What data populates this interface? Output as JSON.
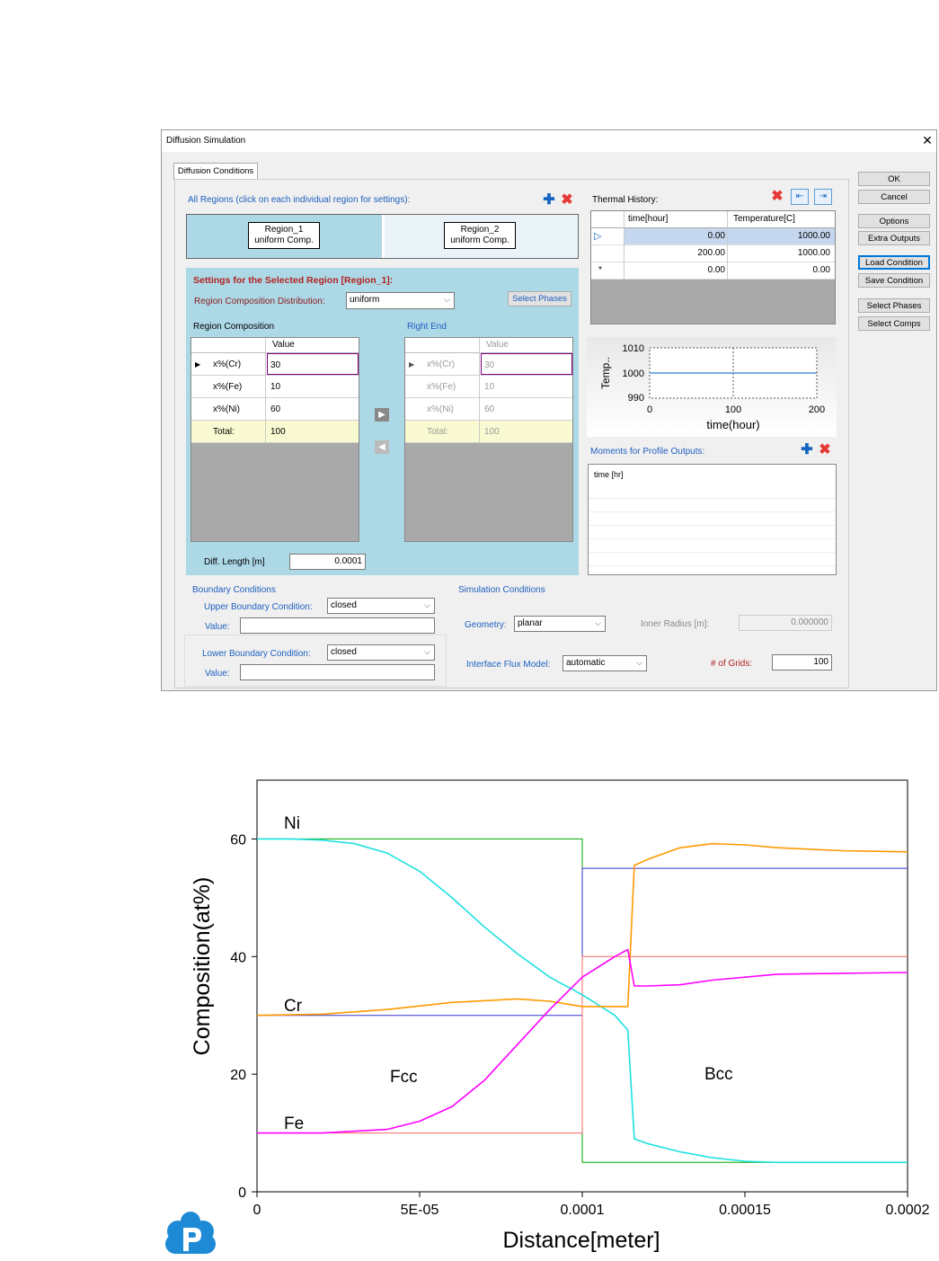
{
  "dialog": {
    "title": "Diffusion Simulation",
    "close": "✕",
    "tab": "Diffusion Conditions",
    "all_regions_label": "All Regions (click on each individual region for settings):",
    "regions": [
      {
        "name": "Region_1",
        "type": "uniform Comp."
      },
      {
        "name": "Region_2",
        "type": "uniform Comp."
      }
    ],
    "settings_title": "Settings for the Selected Region [Region_1]:",
    "distribution_label": "Region Composition Distribution:",
    "distribution_value": "uniform",
    "select_phases_inner": "Select Phases",
    "region_comp_label": "Region Composition",
    "right_end_label": "Right End",
    "comp_header": "Value",
    "comp_rows": [
      {
        "name": "x%(Cr)",
        "value": "30"
      },
      {
        "name": "x%(Fe)",
        "value": "10"
      },
      {
        "name": "x%(Ni)",
        "value": "60"
      },
      {
        "name": "Total:",
        "value": "100"
      }
    ],
    "diff_length_label": "Diff. Length [m]",
    "diff_length_value": "0.0001",
    "thermal_label": "Thermal History:",
    "thermal_headers": [
      "time[hour]",
      "Temperature[C]"
    ],
    "thermal_rows": [
      {
        "marker": "▷",
        "time": "0.00",
        "temp": "1000.00"
      },
      {
        "marker": "",
        "time": "200.00",
        "temp": "1000.00"
      },
      {
        "marker": "*",
        "time": "0.00",
        "temp": "0.00"
      }
    ],
    "mini_chart": {
      "ylabel": "Temp..",
      "xlabel": "time(hour)",
      "yticks": [
        "1010",
        "1000",
        "990"
      ],
      "xticks": [
        "0",
        "100",
        "200"
      ]
    },
    "moments_label": "Moments for Profile Outputs:",
    "moments_header": "time [hr]",
    "boundary_group": "Boundary Conditions",
    "upper_label": "Upper Boundary Condition:",
    "upper_value": "closed",
    "lower_label": "Lower Boundary Condition:",
    "lower_value": "closed",
    "value_label": "Value:",
    "sim_group": "Simulation Conditions",
    "geometry_label": "Geometry:",
    "geometry_value": "planar",
    "inner_radius_label": "Inner Radius [m]:",
    "inner_radius_value": "0.000000",
    "flux_label": "Interface Flux Model:",
    "flux_value": "automatic",
    "grids_label": "# of Grids:",
    "grids_value": "100",
    "side_buttons": [
      "OK",
      "Cancel",
      "Options",
      "Extra Outputs",
      "Load Condition",
      "Save Condition",
      "Select Phases",
      "Select Comps"
    ]
  },
  "chart_data": {
    "type": "line",
    "xlabel": "Distance[meter]",
    "ylabel": "Composition(at%)",
    "xlim": [
      0,
      0.0002
    ],
    "ylim": [
      0,
      70
    ],
    "xticks": [
      "0",
      "5E-05",
      "0.0001",
      "0.00015",
      "0.0002"
    ],
    "yticks": [
      "0",
      "20",
      "40",
      "60"
    ],
    "annotations": [
      "Ni",
      "Cr",
      "Fe",
      "Fcc",
      "Bcc"
    ],
    "series": [
      {
        "name": "Ni",
        "color": "#1fe0e0",
        "x": [
          0,
          1e-05,
          2e-05,
          3e-05,
          4e-05,
          5e-05,
          6e-05,
          7e-05,
          8e-05,
          9e-05,
          0.0001,
          0.00011,
          0.000114,
          0.000116,
          0.00012,
          0.00013,
          0.00014,
          0.00015,
          0.00016,
          0.00018,
          0.0002
        ],
        "y": [
          60,
          60,
          59.8,
          59.2,
          57.6,
          54.5,
          50,
          45,
          40.5,
          36.5,
          33.5,
          30,
          27.5,
          9,
          8.2,
          6.8,
          5.8,
          5.2,
          5,
          5,
          5
        ]
      },
      {
        "name": "Cr",
        "color": "#ff9900",
        "x": [
          0,
          2e-05,
          4e-05,
          6e-05,
          8e-05,
          9e-05,
          0.0001,
          0.00011,
          0.000114,
          0.000116,
          0.00012,
          0.00013,
          0.00014,
          0.00015,
          0.00016,
          0.00018,
          0.0002
        ],
        "y": [
          30,
          30.2,
          31,
          32.2,
          32.8,
          32.4,
          31.5,
          31.5,
          31.5,
          55.5,
          56.5,
          58.5,
          59.2,
          59,
          58.5,
          58,
          57.8
        ]
      },
      {
        "name": "Fe",
        "color": "#ff00ff",
        "x": [
          0,
          2e-05,
          4e-05,
          5e-05,
          6e-05,
          7e-05,
          8e-05,
          9e-05,
          0.0001,
          0.00011,
          0.000114,
          0.000116,
          0.00012,
          0.00013,
          0.00014,
          0.00016,
          0.0002
        ],
        "y": [
          10,
          10,
          10.6,
          12,
          14.5,
          19,
          25,
          31,
          36.5,
          40,
          41.2,
          35,
          35,
          35.2,
          36,
          37,
          37.3
        ]
      }
    ],
    "initial_profiles": [
      {
        "name": "Ni initial",
        "color": "#00aa00",
        "x": [
          0,
          0.0001,
          0.0001,
          0.0002
        ],
        "y": [
          60,
          60,
          5,
          5
        ]
      },
      {
        "name": "Cr initial",
        "color": "#3333cc",
        "x": [
          0,
          0.0001,
          0.0001,
          0.0002
        ],
        "y": [
          30,
          30,
          55,
          55
        ]
      },
      {
        "name": "Fe initial",
        "color": "#ff6666",
        "x": [
          0,
          0.0001,
          0.0001,
          0.0002
        ],
        "y": [
          10,
          10,
          40,
          40
        ]
      }
    ]
  }
}
